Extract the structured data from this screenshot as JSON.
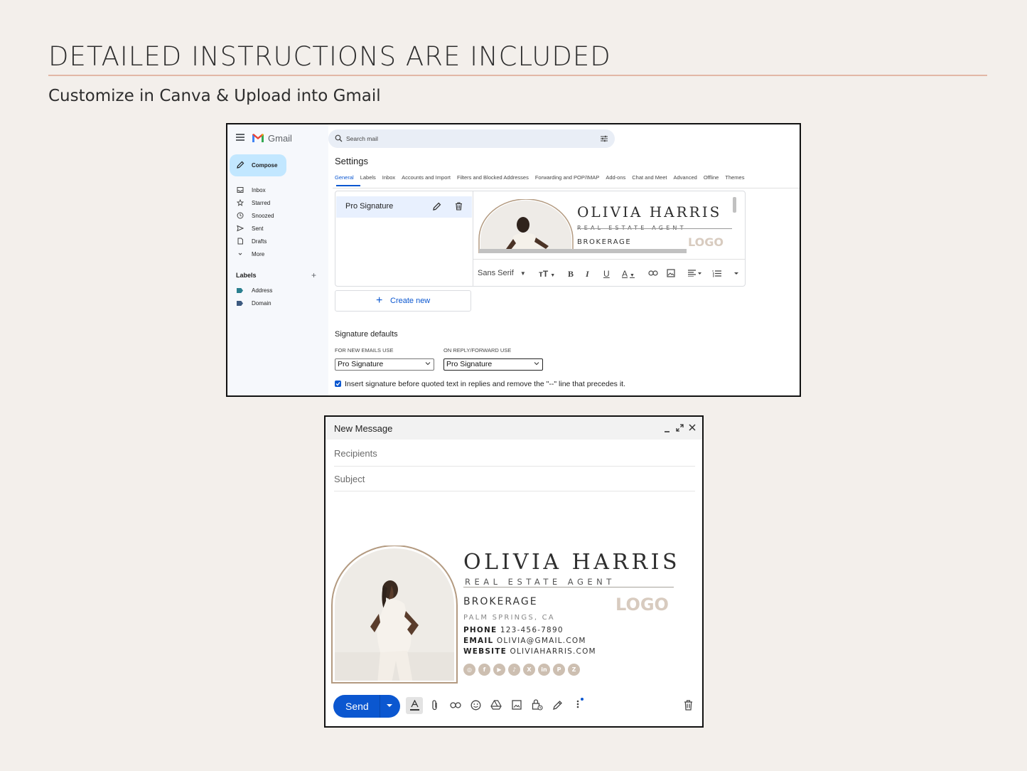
{
  "header": {
    "title": "DETAILED INSTRUCTIONS ARE INCLUDED",
    "subtitle": "Customize in Canva & Upload into Gmail"
  },
  "gmail_settings": {
    "app_name": "Gmail",
    "compose_label": "Compose",
    "nav": [
      "Inbox",
      "Starred",
      "Snoozed",
      "Sent",
      "Drafts",
      "More"
    ],
    "labels_heading": "Labels",
    "labels": [
      "Address",
      "Domain"
    ],
    "search_placeholder": "Search mail",
    "page_title": "Settings",
    "tabs": [
      "General",
      "Labels",
      "Inbox",
      "Accounts and Import",
      "Filters and Blocked Addresses",
      "Forwarding and POP/IMAP",
      "Add-ons",
      "Chat and Meet",
      "Advanced",
      "Offline",
      "Themes"
    ],
    "active_tab": "General",
    "signature_name": "Pro Signature",
    "editor_font": "Sans Serif",
    "create_new_label": "Create new",
    "defaults_title": "Signature defaults",
    "new_emails_label": "FOR NEW EMAILS USE",
    "new_emails_value": "Pro Signature",
    "reply_label": "ON REPLY/FORWARD USE",
    "reply_value": "Pro Signature",
    "insert_checkbox_label": "Insert signature before quoted text in replies and remove the \"--\" line that precedes it.",
    "insert_checkbox_checked": true
  },
  "new_message": {
    "title": "New Message",
    "recipients_placeholder": "Recipients",
    "subject_placeholder": "Subject",
    "send_label": "Send"
  },
  "signature": {
    "name": "OLIVIA HARRIS",
    "role": "REAL ESTATE AGENT",
    "brokerage": "BROKERAGE",
    "location": "PALM SPRINGS, CA",
    "logo": "LOGO",
    "phone_label": "PHONE",
    "phone": "123-456-7890",
    "email_label": "EMAIL",
    "email": "OLIVIA@GMAIL.COM",
    "website_label": "WEBSITE",
    "website": "OLIVIAHARRIS.COM",
    "social_icons": [
      "instagram-icon",
      "facebook-icon",
      "youtube-icon",
      "tiktok-icon",
      "x-icon",
      "linkedin-icon",
      "pinterest-icon",
      "zillow-icon"
    ]
  },
  "colors": {
    "background": "#f3efeb",
    "rule": "#e2b7a6",
    "gmail_blue": "#0b57d0",
    "compose_bg": "#c2e7ff",
    "accent_tan": "#cdbfb1",
    "logo_tan": "#d8cbbf",
    "arch_border": "#b39a80"
  }
}
